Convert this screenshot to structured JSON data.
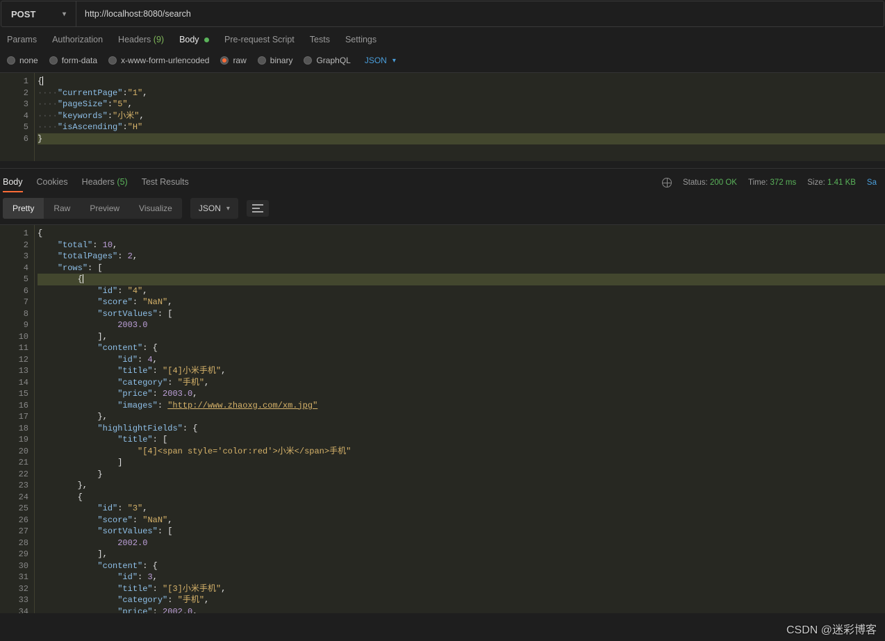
{
  "request": {
    "method": "POST",
    "url": "http://localhost:8080/search"
  },
  "tabs": {
    "params": "Params",
    "authorization": "Authorization",
    "headers": "Headers",
    "headers_count": "(9)",
    "body": "Body",
    "prerequest": "Pre-request Script",
    "tests": "Tests",
    "settings": "Settings"
  },
  "bodyTypes": {
    "none": "none",
    "formdata": "form-data",
    "xwww": "x-www-form-urlencoded",
    "raw": "raw",
    "binary": "binary",
    "graphql": "GraphQL",
    "langsel": "JSON"
  },
  "reqBodyLines": [
    "1",
    "2",
    "3",
    "4",
    "5",
    "6"
  ],
  "reqBody": {
    "currentPage_k": "\"currentPage\"",
    "currentPage_v": "\"1\"",
    "pageSize_k": "\"pageSize\"",
    "pageSize_v": "\"5\"",
    "keywords_k": "\"keywords\"",
    "keywords_v": "\"小米\"",
    "isAscending_k": "\"isAscending\"",
    "isAscending_v": "\"H\""
  },
  "respTabs": {
    "body": "Body",
    "cookies": "Cookies",
    "headers": "Headers",
    "headers_count": "(5)",
    "test": "Test Results"
  },
  "status": {
    "status_lbl": "Status:",
    "status_val": "200 OK",
    "time_lbl": "Time:",
    "time_val": "372 ms",
    "size_lbl": "Size:",
    "size_val": "1.41 KB",
    "save": "Sa"
  },
  "prettyRow": {
    "pretty": "Pretty",
    "raw": "Raw",
    "preview": "Preview",
    "visualize": "Visualize",
    "sel": "JSON"
  },
  "respLines": [
    "1",
    "2",
    "3",
    "4",
    "5",
    "6",
    "7",
    "8",
    "9",
    "10",
    "11",
    "12",
    "13",
    "14",
    "15",
    "16",
    "17",
    "18",
    "19",
    "20",
    "21",
    "22",
    "23",
    "24",
    "25",
    "26",
    "27",
    "28",
    "29",
    "30",
    "31",
    "32",
    "33",
    "34"
  ],
  "resp": {
    "open": "{",
    "total_k": "\"total\"",
    "total_v": "10",
    "totalPages_k": "\"totalPages\"",
    "totalPages_v": "2",
    "rows_k": "\"rows\"",
    "id_k": "\"id\"",
    "id4": "\"4\"",
    "id3": "\"3\"",
    "score_k": "\"score\"",
    "nan": "\"NaN\"",
    "sortValues_k": "\"sortValues\"",
    "sv4": "2003.0",
    "sv3": "2002.0",
    "content_k": "\"content\"",
    "cid4": "4",
    "cid3": "3",
    "title_k": "\"title\"",
    "title4": "\"[4]小米手机\"",
    "title3": "\"[3]小米手机\"",
    "category_k": "\"category\"",
    "category_v": "\"手机\"",
    "price_k": "\"price\"",
    "price4": "2003.0",
    "price3": "2002.0",
    "images_k": "\"images\"",
    "images_v": "\"http://www.zhaoxg.com/xm.jpg\"",
    "hl_k": "\"highlightFields\"",
    "hlt": "\"[4]<span style='color:red'>小米</span>手机\""
  },
  "watermark": "CSDN @迷彩博客"
}
